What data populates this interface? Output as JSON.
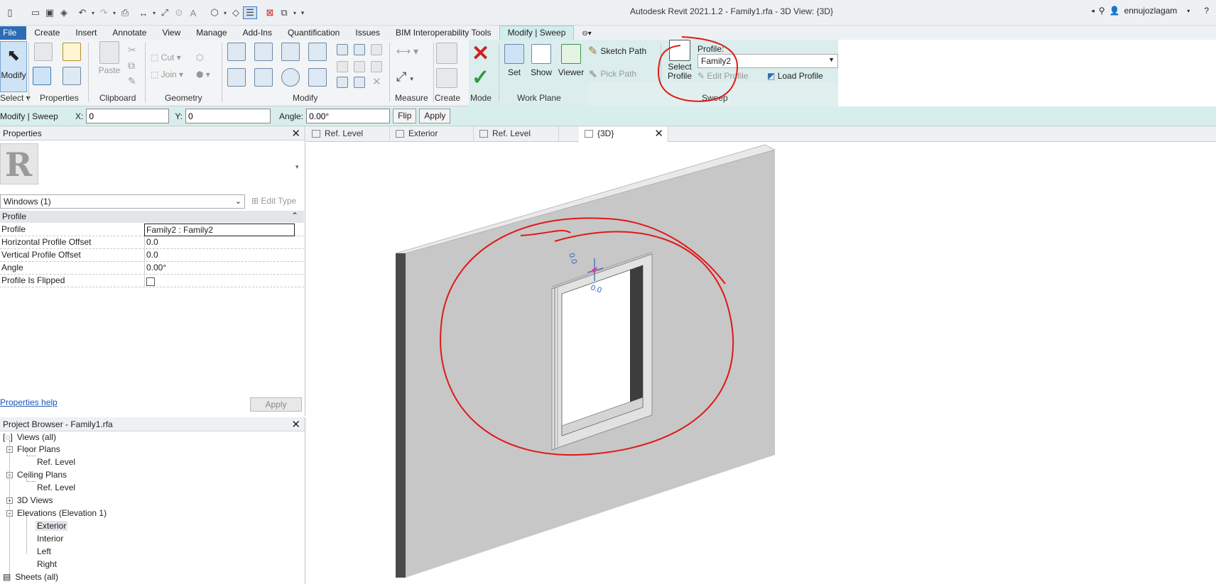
{
  "window": {
    "title": "Autodesk Revit 2021.1.2 - Family1.rfa - 3D View: {3D}",
    "user": "ennujozlagam"
  },
  "ribbon_tabs": [
    {
      "label": "File"
    },
    {
      "label": "Create"
    },
    {
      "label": "Insert"
    },
    {
      "label": "Annotate"
    },
    {
      "label": "View"
    },
    {
      "label": "Manage"
    },
    {
      "label": "Add-Ins"
    },
    {
      "label": "Quantification"
    },
    {
      "label": "Issues"
    },
    {
      "label": "BIM Interoperability Tools"
    },
    {
      "label": "Modify | Sweep"
    }
  ],
  "ribbon": {
    "modify": "Modify",
    "select": "Select",
    "paste": "Paste",
    "cut": "Cut",
    "join": "Join",
    "set": "Set",
    "show": "Show",
    "viewer": "Viewer",
    "sketch_path": "Sketch Path",
    "pick_path": "Pick Path",
    "select_profile_1": "Select",
    "select_profile_2": "Profile",
    "profile_label": "Profile:",
    "profile_value": "Family2",
    "edit_profile": "Edit Profile",
    "load_profile": "Load Profile",
    "panels": {
      "select": "Select",
      "properties": "Properties",
      "clipboard": "Clipboard",
      "geometry": "Geometry",
      "modify": "Modify",
      "measure": "Measure",
      "create": "Create",
      "mode": "Mode",
      "work_plane": "Work Plane",
      "sweep": "Sweep"
    }
  },
  "options_bar": {
    "context": "Modify | Sweep",
    "x_label": "X:",
    "x_value": "0",
    "y_label": "Y:",
    "y_value": "0",
    "angle_label": "Angle:",
    "angle_value": "0.00°",
    "flip": "Flip",
    "apply": "Apply"
  },
  "properties": {
    "title": "Properties",
    "type_selector": "Windows (1)",
    "edit_type": "Edit Type",
    "group": "Profile",
    "rows": [
      {
        "key": "Profile",
        "value": "Family2 : Family2"
      },
      {
        "key": "Horizontal Profile Offset",
        "value": "0.0"
      },
      {
        "key": "Vertical Profile Offset",
        "value": "0.0"
      },
      {
        "key": "Angle",
        "value": "0.00°"
      },
      {
        "key": "Profile Is Flipped",
        "value": ""
      }
    ],
    "help": "Properties help",
    "apply": "Apply"
  },
  "browser": {
    "title": "Project Browser - Family1.rfa",
    "nodes": {
      "views": "Views (all)",
      "floor_plans": "Floor Plans",
      "fp_ref": "Ref. Level",
      "ceiling_plans": "Ceiling Plans",
      "cp_ref": "Ref. Level",
      "views_3d": "3D Views",
      "elevations": "Elevations (Elevation 1)",
      "exterior": "Exterior",
      "interior": "Interior",
      "left": "Left",
      "right": "Right",
      "sheets": "Sheets (all)"
    }
  },
  "view_tabs": [
    {
      "label": "Ref. Level"
    },
    {
      "label": "Exterior"
    },
    {
      "label": "Ref. Level"
    },
    {
      "label": "{3D}"
    }
  ],
  "viewport": {
    "dim_top": "0.0",
    "dim_side": "0.0"
  },
  "colors": {
    "annotation": "#e01818",
    "file_tab": "#2d6bb4",
    "context_ribbon": "#dbeeed"
  }
}
